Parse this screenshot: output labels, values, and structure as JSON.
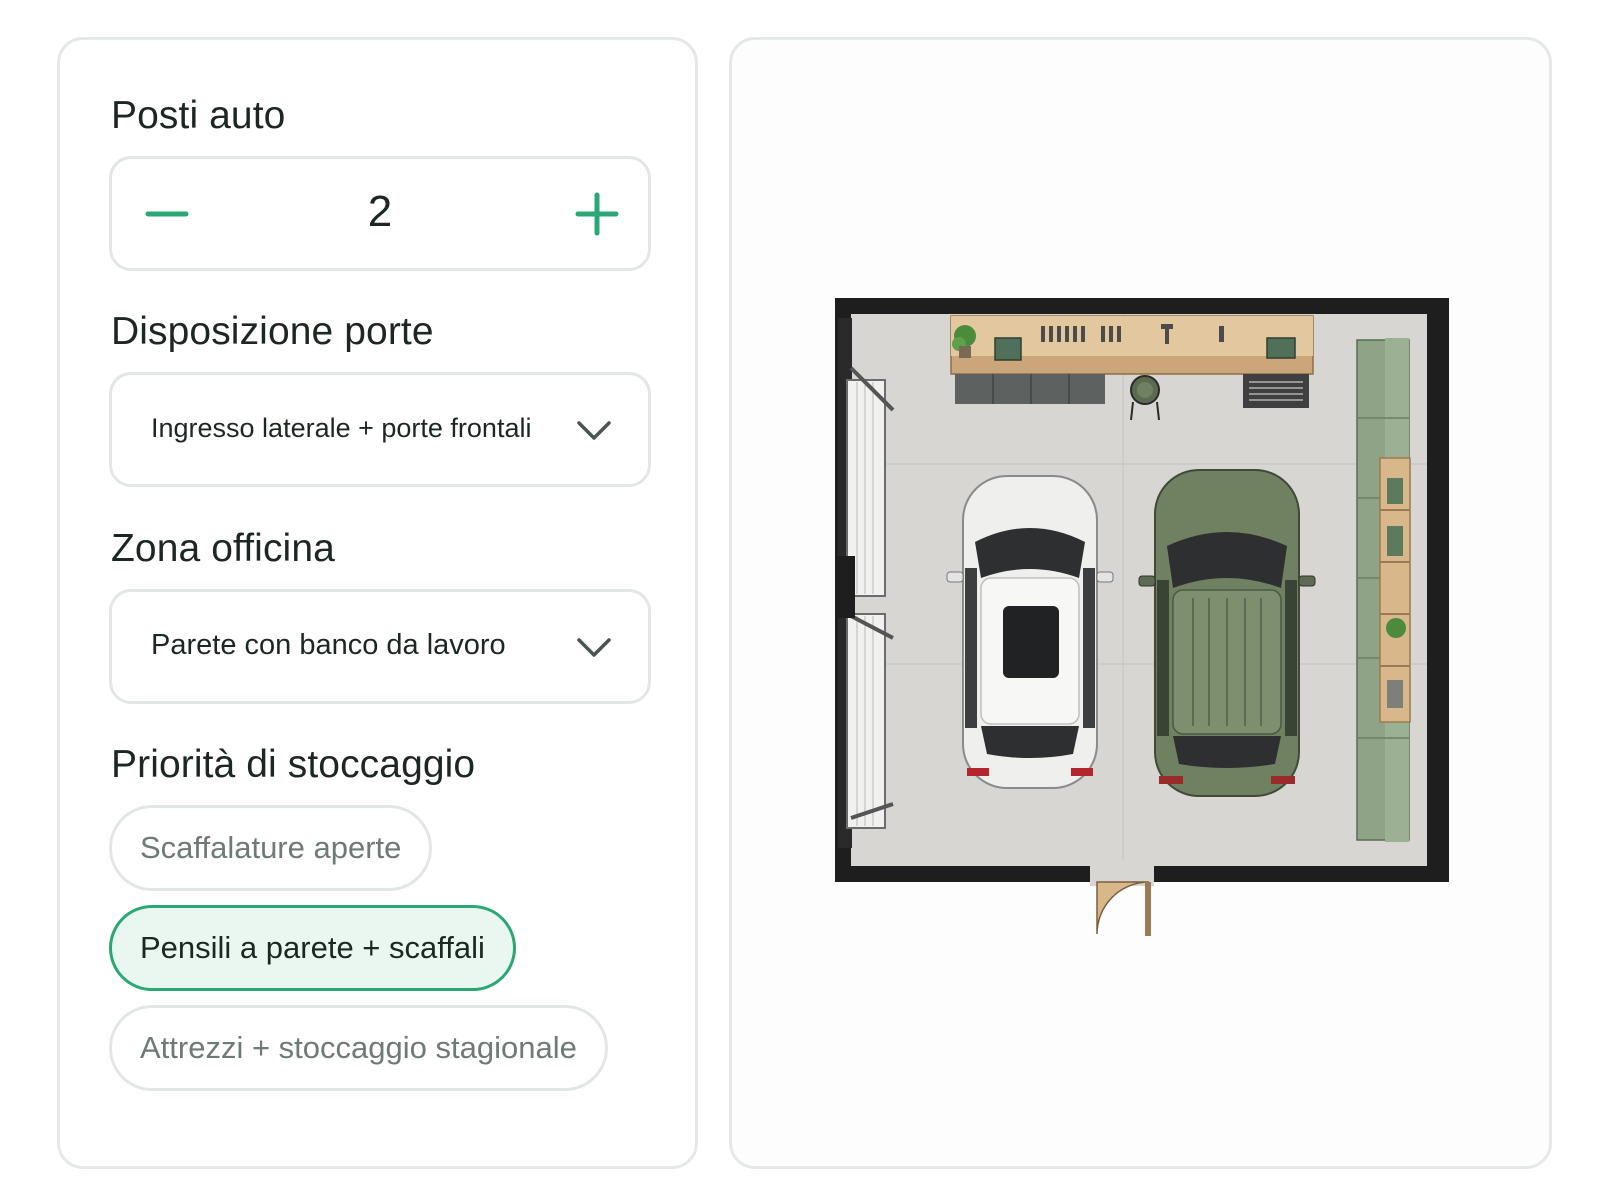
{
  "controls": {
    "parking": {
      "label": "Posti auto",
      "value": "2",
      "decrement_icon": "minus-icon",
      "increment_icon": "plus-icon"
    },
    "doors": {
      "label": "Disposizione porte",
      "selected": "Ingresso laterale + porte frontali"
    },
    "workshop": {
      "label": "Zona officina",
      "selected": "Parete con banco da lavoro"
    },
    "storage": {
      "label": "Priorità di stoccaggio",
      "options": [
        {
          "label": "Scaffalature aperte",
          "selected": false
        },
        {
          "label": "Pensili a parete + scaffali",
          "selected": true
        },
        {
          "label": "Attrezzi + stoccaggio stagionale",
          "selected": false
        }
      ]
    }
  },
  "colors": {
    "accent": "#2aa774",
    "accent_bg": "#e9f7f0",
    "border": "#e2e7e4",
    "car_white": "#f2f2f0",
    "car_green": "#6f8160",
    "cabinet_green": "#8fa487",
    "wall": "#1e1e1e",
    "floor": "#d7d6d2",
    "wood": "#d8b88a"
  }
}
